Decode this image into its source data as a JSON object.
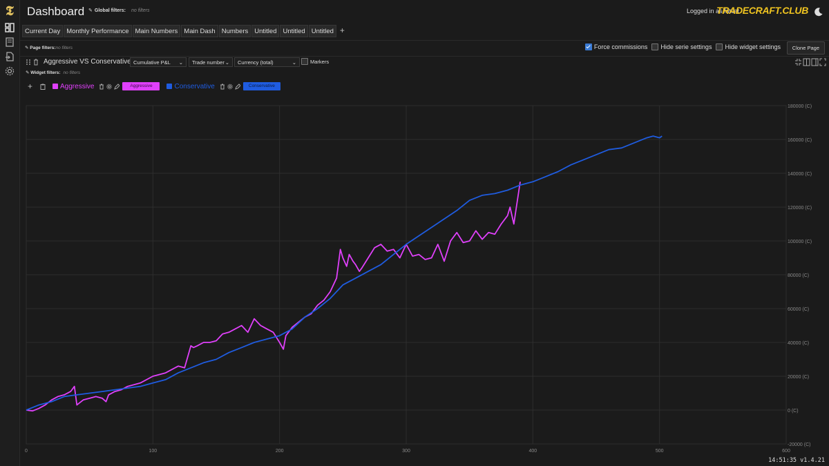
{
  "app": {
    "title": "Dashboard",
    "brand": "TRADECRAFT.CLUB",
    "login_text": "Logged in as fatcat",
    "version_status": "14:51:35  v1.4.21"
  },
  "global_filters": {
    "label": "Global filters:",
    "value": "no filters"
  },
  "tabs": [
    {
      "label": "Current Day"
    },
    {
      "label": "Monthly Performance"
    },
    {
      "label": "Main Numbers"
    },
    {
      "label": "Main Dash",
      "active": true
    },
    {
      "label": "Numbers"
    },
    {
      "label": "Untitled"
    },
    {
      "label": "Untitled"
    },
    {
      "label": "Untitled"
    }
  ],
  "page_filters": {
    "label": "Page filters:",
    "value": "no filters"
  },
  "options": {
    "force_commissions": {
      "label": "Force commissions",
      "checked": true
    },
    "hide_serie_settings": {
      "label": "Hide serie settings",
      "checked": false
    },
    "hide_widget_settings": {
      "label": "Hide widget settings",
      "checked": false
    },
    "clone_page": "Clone Page"
  },
  "widget": {
    "title": "Aggressive VS Conservative",
    "selects": {
      "metric": "Cumulative P&L",
      "xaxis": "Trade number",
      "unit": "Currency (total)"
    },
    "markers": {
      "label": "Markers",
      "checked": false
    },
    "filters": {
      "label": "Widget filters:",
      "value": "no filters"
    }
  },
  "colors": {
    "aggressive": "#e040fb",
    "conservative": "#1f5ce0"
  },
  "legend": [
    {
      "name": "Aggressive",
      "button": "Aggressive"
    },
    {
      "name": "Conservative",
      "button": "Conservative"
    }
  ],
  "chart_data": {
    "type": "line",
    "xlim": [
      0,
      600
    ],
    "ylim": [
      -20000,
      180000
    ],
    "x_ticks": [
      "0",
      "100",
      "200",
      "300",
      "400",
      "500",
      "600"
    ],
    "y_ticks": [
      "-20000 (C)",
      "0 (C)",
      "20000 (C)",
      "40000 (C)",
      "60000 (C)",
      "80000 (C)",
      "100000 (C)",
      "120000 (C)",
      "140000 (C)",
      "160000 (C)",
      "180000 (C)"
    ],
    "grid": true,
    "series": [
      {
        "name": "Aggressive",
        "x": [
          0,
          5,
          10,
          15,
          20,
          25,
          30,
          35,
          38,
          40,
          45,
          50,
          55,
          60,
          63,
          65,
          70,
          75,
          80,
          90,
          100,
          110,
          115,
          120,
          125,
          130,
          132,
          135,
          140,
          145,
          150,
          155,
          160,
          165,
          170,
          175,
          180,
          185,
          190,
          195,
          200,
          203,
          205,
          210,
          215,
          220,
          225,
          230,
          235,
          240,
          245,
          248,
          250,
          253,
          255,
          258,
          260,
          263,
          265,
          270,
          275,
          280,
          285,
          290,
          295,
          300,
          305,
          310,
          315,
          320,
          325,
          330,
          335,
          340,
          345,
          350,
          355,
          360,
          365,
          370,
          375,
          380,
          382,
          385,
          390
        ],
        "values": [
          0,
          -500,
          1000,
          3000,
          6000,
          8000,
          9000,
          11000,
          14000,
          3000,
          6000,
          7000,
          8000,
          7000,
          5000,
          9000,
          11000,
          12000,
          14000,
          16000,
          20000,
          22000,
          24000,
          26000,
          25000,
          38000,
          37000,
          38000,
          40000,
          40000,
          41000,
          45000,
          46000,
          48000,
          50000,
          46000,
          54000,
          50000,
          48000,
          46000,
          40000,
          36000,
          44000,
          49000,
          52000,
          55000,
          57000,
          62000,
          65000,
          70000,
          78000,
          95000,
          90000,
          85000,
          92000,
          88000,
          86000,
          82000,
          84000,
          90000,
          96000,
          98000,
          94000,
          95000,
          90000,
          98000,
          91000,
          92000,
          89000,
          90000,
          98000,
          88000,
          100000,
          105000,
          99000,
          100000,
          106000,
          101000,
          105000,
          104000,
          110000,
          115000,
          120000,
          110000,
          135000
        ]
      },
      {
        "name": "Conservative",
        "x": [
          0,
          10,
          20,
          30,
          40,
          50,
          60,
          70,
          80,
          90,
          100,
          110,
          120,
          130,
          140,
          150,
          160,
          170,
          180,
          190,
          200,
          210,
          220,
          230,
          240,
          250,
          260,
          270,
          280,
          290,
          300,
          310,
          320,
          330,
          340,
          350,
          360,
          370,
          380,
          390,
          400,
          410,
          420,
          430,
          440,
          450,
          460,
          470,
          480,
          490,
          495,
          500,
          502
        ],
        "values": [
          0,
          3000,
          5000,
          8000,
          9000,
          10000,
          11000,
          12000,
          13000,
          14000,
          16000,
          18000,
          22000,
          25000,
          28000,
          30000,
          34000,
          37000,
          40000,
          42000,
          44000,
          48000,
          55000,
          60000,
          66000,
          74000,
          78000,
          82000,
          86000,
          92000,
          98000,
          103000,
          108000,
          113000,
          118000,
          124000,
          127000,
          128000,
          130000,
          133000,
          135000,
          138000,
          141000,
          145000,
          148000,
          151000,
          154000,
          155000,
          158000,
          161000,
          162000,
          161000,
          162000
        ]
      }
    ]
  }
}
